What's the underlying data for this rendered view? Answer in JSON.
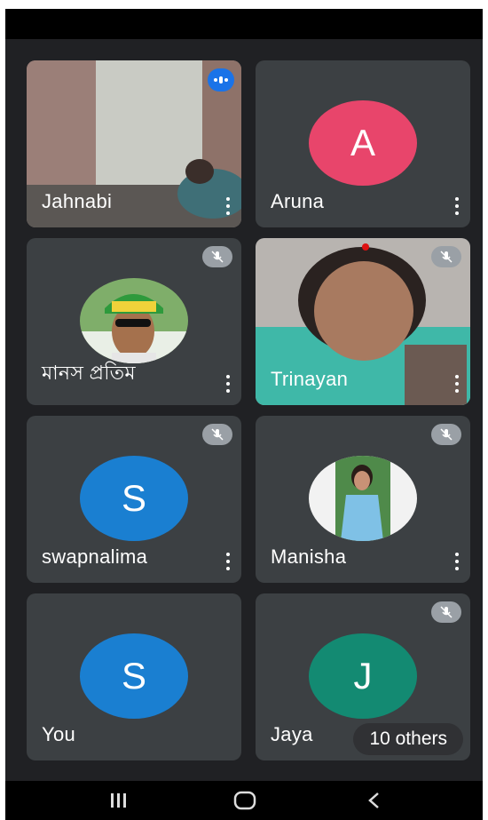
{
  "participants": [
    {
      "name": "Jahnabi",
      "type": "video",
      "status": "speaking"
    },
    {
      "name": "Aruna",
      "type": "initial",
      "initial": "A",
      "color": "#e8456b",
      "status": "unmuted"
    },
    {
      "name": "মানস প্রতিম",
      "type": "photo",
      "status": "muted"
    },
    {
      "name": "Trinayan",
      "type": "video",
      "status": "muted"
    },
    {
      "name": "swapnalima",
      "type": "initial",
      "initial": "S",
      "color": "#1a7fd1",
      "status": "muted"
    },
    {
      "name": "Manisha",
      "type": "photo",
      "status": "muted"
    },
    {
      "name": "You",
      "type": "initial",
      "initial": "S",
      "color": "#1a7fd1",
      "status": "unmuted"
    },
    {
      "name": "Jaya",
      "type": "initial",
      "initial": "J",
      "color": "#138a72",
      "status": "muted",
      "overflow_label": "10 others"
    }
  ],
  "colors": {
    "background": "#202124",
    "tile": "#3c4043",
    "mute_badge": "#9aa0a6",
    "speaking_badge": "#1a73e8"
  },
  "nav": {
    "recents_icon": "recents-icon",
    "home_icon": "home-icon",
    "back_icon": "back-icon"
  }
}
